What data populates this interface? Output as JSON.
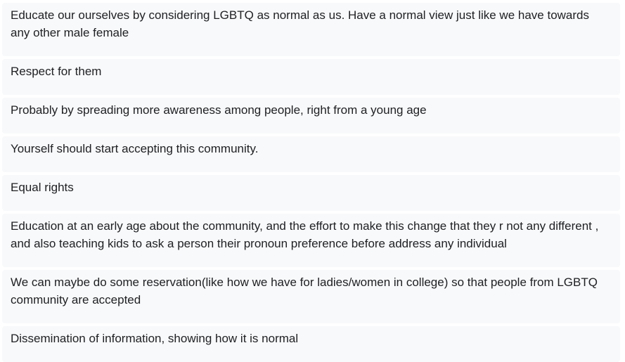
{
  "responses": [
    "Educate our ourselves by considering LGBTQ as normal as us. Have a normal view just like we have towards any other male female",
    "Respect for them",
    "Probably by spreading more awareness among people, right from a young age",
    "Yourself should start accepting this community.",
    "Equal rights",
    "Education at an early age about the community, and the effort to make this change that they r not any different , and also teaching kids to ask a person their pronoun preference before address any individual",
    "We can maybe do some reservation(like how we have for ladies/women in college) so that people from LGBTQ community are accepted",
    "Dissemination of information, showing how it is normal"
  ],
  "colors": {
    "card_background": "#f8f9fa",
    "text": "#202124"
  }
}
